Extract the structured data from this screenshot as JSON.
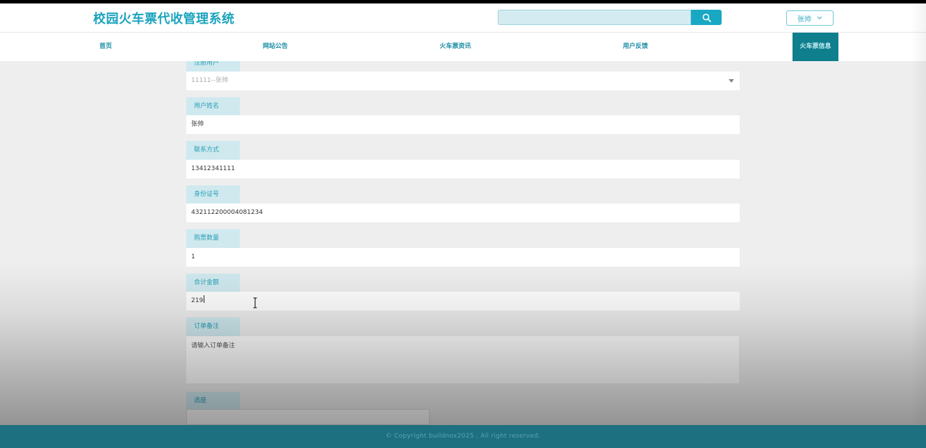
{
  "site": {
    "title": "校园火车票代收管理系统"
  },
  "search": {
    "placeholder": ""
  },
  "user": {
    "name": "张帅"
  },
  "nav": {
    "items": [
      {
        "label": "首页"
      },
      {
        "label": "网站公告"
      },
      {
        "label": "火车票资讯"
      },
      {
        "label": "用户反馈"
      },
      {
        "label": "火车票信息",
        "active": true
      }
    ]
  },
  "form": {
    "registered_user": {
      "label": "注册用户",
      "value": "11111--张帅"
    },
    "user_name": {
      "label": "用户姓名",
      "value": "张帅"
    },
    "contact": {
      "label": "联系方式",
      "value": "13412341111"
    },
    "id_number": {
      "label": "身份证号",
      "value": "432112200004081234"
    },
    "quantity": {
      "label": "购票数量",
      "value": "1"
    },
    "total": {
      "label": "合计金额",
      "value": "219"
    },
    "remark": {
      "label": "订单备注",
      "placeholder": "请输入订单备注"
    },
    "seat": {
      "label": "选座"
    }
  },
  "footer": {
    "text": "© Copyright buildnox2025 . All right reserved."
  },
  "colors": {
    "accent": "#1ba3bd",
    "nav_active": "#0f7e8d",
    "footer": "#1d7080",
    "label_bg": "#cfe9ef"
  }
}
